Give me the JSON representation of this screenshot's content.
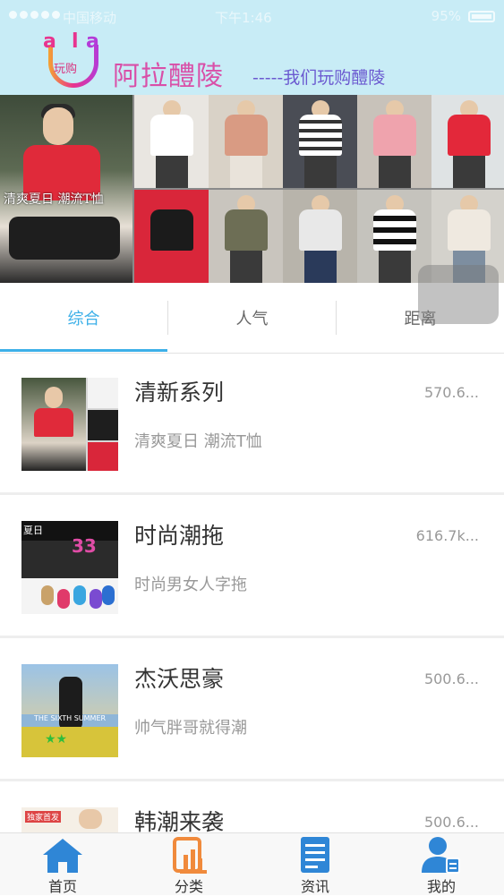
{
  "status_bar": {
    "carrier": "中国移动",
    "time": "下午1:46",
    "battery": "95%"
  },
  "header": {
    "logo_letters": [
      "a",
      "l",
      "a"
    ],
    "logo_text": "玩购",
    "brand_name": "阿拉醴陵",
    "slogan": "-----我们玩购醴陵",
    "background": "#c8ecf6"
  },
  "banner": {
    "caption": "清爽夏日 潮流T恤"
  },
  "tabs": [
    {
      "label": "综合",
      "active": true
    },
    {
      "label": "人气",
      "active": false
    },
    {
      "label": "距离",
      "active": false
    }
  ],
  "list": [
    {
      "title": "清新系列",
      "subtitle": "清爽夏日 潮流T恤",
      "distance": "570.6..."
    },
    {
      "title": "时尚潮拖",
      "subtitle": "时尚男女人字拖",
      "distance": "616.7k..."
    },
    {
      "title": "杰沃思豪",
      "subtitle": "帅气胖哥就得潮",
      "distance": "500.6..."
    },
    {
      "title": "韩潮来袭",
      "subtitle": "",
      "distance": "500.6..."
    }
  ],
  "thumb_labels": {
    "thumb2_tag": "夏日",
    "thumb3_caption": "THE SIXTH SUMMER",
    "thumb4_tag": "独家首发"
  },
  "bottom_nav": [
    {
      "label": "首页",
      "icon": "home-icon"
    },
    {
      "label": "分类",
      "icon": "category-icon"
    },
    {
      "label": "资讯",
      "icon": "news-icon"
    },
    {
      "label": "我的",
      "icon": "profile-icon"
    }
  ],
  "colors": {
    "accent": "#3db0e8",
    "icon_blue": "#2f86d6",
    "icon_orange": "#f08a3c"
  }
}
